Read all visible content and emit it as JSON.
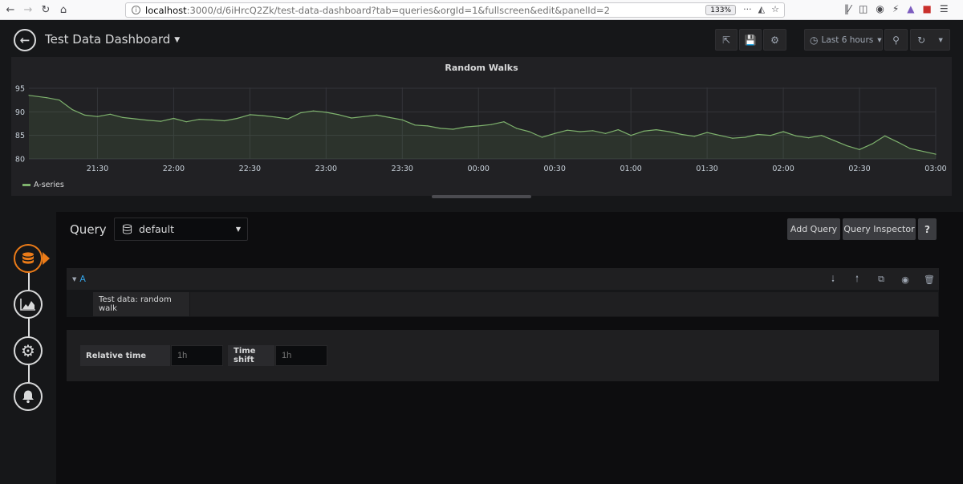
{
  "browser": {
    "url_host": "localhost",
    "url_rest": ":3000/d/6iHrcQ2Zk/test-data-dashboard?tab=queries&orgId=1&fullscreen&edit&panelId=2",
    "zoom": "133%"
  },
  "header": {
    "title": "Test Data Dashboard",
    "time_range": "Last 6 hours"
  },
  "panel": {
    "title": "Random Walks",
    "legend": "A-series"
  },
  "chart_data": {
    "type": "line",
    "title": "Random Walks",
    "ylim": [
      80,
      95
    ],
    "yticks": [
      "95",
      "90",
      "85",
      "80"
    ],
    "xticks": [
      "21:30",
      "22:00",
      "22:30",
      "23:00",
      "23:30",
      "00:00",
      "00:30",
      "01:00",
      "01:30",
      "02:00",
      "02:30",
      "03:00"
    ],
    "grid": true,
    "legend_position": "bottom-left",
    "series": [
      {
        "name": "A-series",
        "color": "#7eb26d",
        "x": [
          "21:03",
          "21:10",
          "21:15",
          "21:20",
          "21:25",
          "21:30",
          "21:35",
          "21:40",
          "21:45",
          "21:50",
          "21:55",
          "22:00",
          "22:05",
          "22:10",
          "22:15",
          "22:20",
          "22:25",
          "22:30",
          "22:35",
          "22:40",
          "22:45",
          "22:50",
          "22:55",
          "23:00",
          "23:05",
          "23:10",
          "23:15",
          "23:20",
          "23:25",
          "23:30",
          "23:35",
          "23:40",
          "23:45",
          "23:50",
          "23:55",
          "00:00",
          "00:05",
          "00:10",
          "00:15",
          "00:20",
          "00:25",
          "00:30",
          "00:35",
          "00:40",
          "00:45",
          "00:50",
          "00:55",
          "01:00",
          "01:05",
          "01:10",
          "01:15",
          "01:20",
          "01:25",
          "01:30",
          "01:35",
          "01:40",
          "01:45",
          "01:50",
          "01:55",
          "02:00",
          "02:05",
          "02:10",
          "02:15",
          "02:20",
          "02:25",
          "02:30",
          "02:35",
          "02:40",
          "02:45",
          "02:50",
          "02:55",
          "03:00"
        ],
        "values": [
          93.5,
          93.0,
          92.5,
          90.5,
          89.3,
          89.0,
          89.5,
          88.8,
          88.5,
          88.2,
          88.0,
          88.6,
          87.9,
          88.4,
          88.3,
          88.1,
          88.6,
          89.4,
          89.2,
          88.9,
          88.5,
          89.8,
          90.2,
          89.9,
          89.4,
          88.7,
          89.0,
          89.3,
          88.8,
          88.3,
          87.2,
          87.0,
          86.5,
          86.3,
          86.8,
          87.0,
          87.3,
          87.9,
          86.5,
          85.8,
          84.6,
          85.4,
          86.1,
          85.8,
          86.0,
          85.4,
          86.2,
          85.0,
          85.9,
          86.2,
          85.8,
          85.2,
          84.8,
          85.6,
          85.0,
          84.4,
          84.6,
          85.2,
          85.0,
          85.8,
          84.9,
          84.5,
          85.0,
          83.9,
          82.8,
          82.0,
          83.2,
          84.9,
          83.6,
          82.2,
          81.6,
          81.0
        ]
      }
    ]
  },
  "editor": {
    "query_label": "Query",
    "datasource": "default",
    "add_query": "Add Query",
    "query_inspector": "Query Inspector",
    "help": "?",
    "query_ref": "A",
    "scenario": "Test data: random walk",
    "relative_time_label": "Relative time",
    "relative_time_placeholder": "1h",
    "time_shift_label": "Time shift",
    "time_shift_placeholder": "1h"
  }
}
